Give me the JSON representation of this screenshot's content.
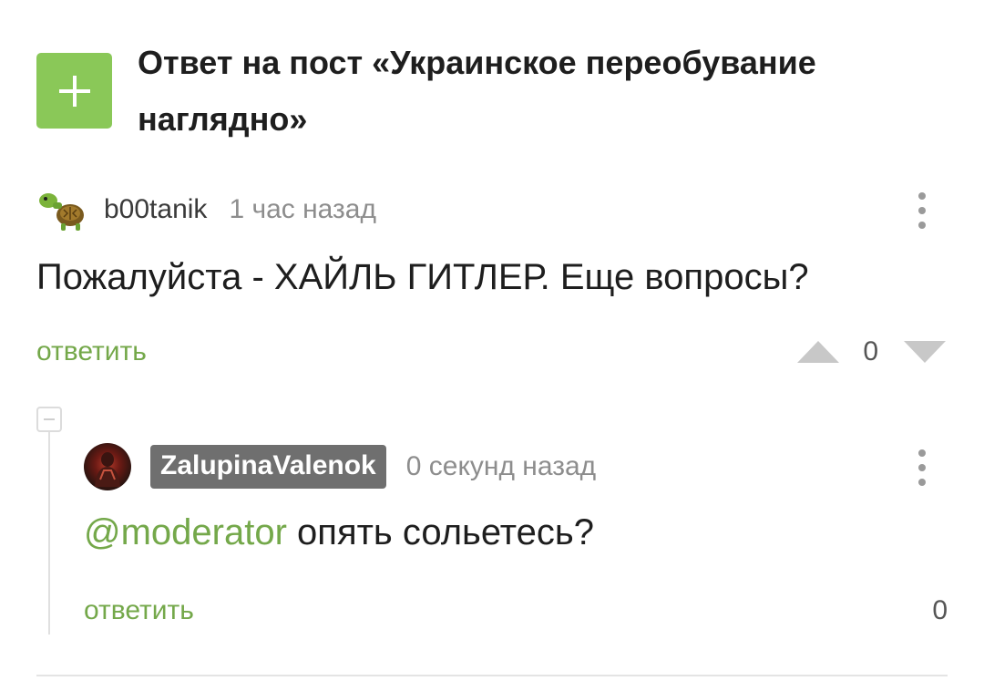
{
  "post": {
    "title": "Ответ на пост «Украинское переобувание наглядно»",
    "add_icon": "plus-icon",
    "accent_color": "#8ac858"
  },
  "comments": [
    {
      "author": "b00tanik",
      "time": "1 час назад",
      "text": "Пожалуйста - ХАЙЛЬ ГИТЛЕР. Еще вопросы?",
      "reply_label": "ответить",
      "score": "0",
      "avatar_icon": "turtle-avatar"
    },
    {
      "author": "ZalupinaValenok",
      "time": "0 секунд назад",
      "mention": "@moderator",
      "text": " опять сольетесь?",
      "reply_label": "ответить",
      "score": "0",
      "avatar_icon": "user-avatar"
    }
  ],
  "colors": {
    "link_green": "#74a84a",
    "badge_gray": "#6f6f6f",
    "vote_gray": "#c8c8c8"
  }
}
